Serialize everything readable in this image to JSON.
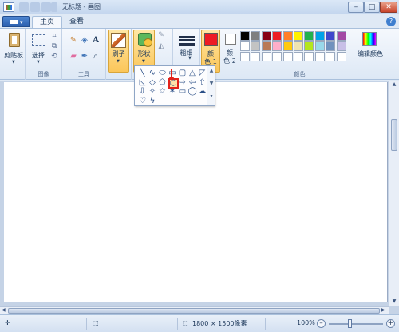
{
  "window": {
    "title_doc": "无标题",
    "title_app": "画图",
    "minimize_glyph": "–",
    "maximize_glyph": "□",
    "close_glyph": "✕"
  },
  "tabs": [
    {
      "label": "主页",
      "active": true
    },
    {
      "label": "查看",
      "active": false
    }
  ],
  "help_glyph": "?",
  "ribbon": {
    "clipboard": {
      "button": "剪贴板",
      "group": ""
    },
    "image": {
      "select": "选择",
      "group": "图像"
    },
    "tools": {
      "group": "工具",
      "pencil": "✎",
      "fill": "◈",
      "text": "A",
      "eraser": "▰",
      "picker": "✒",
      "magnifier": "⌕"
    },
    "brushes": {
      "label": "刷子"
    },
    "shapes": {
      "label": "形状"
    },
    "size": {
      "label": "粗细"
    },
    "color1": {
      "label1": "颜",
      "label2": "色 1",
      "color": "#ed1c24"
    },
    "color2": {
      "label1": "颜",
      "label2": "色 2",
      "color": "#ffffff"
    },
    "colors": {
      "group": "颜色",
      "edit": "编辑颜色",
      "row1": [
        "#000000",
        "#7f7f7f",
        "#880015",
        "#ed1c24",
        "#ff7f27",
        "#fff200",
        "#22b14c",
        "#00a2e8",
        "#3f48cc",
        "#a349a4"
      ],
      "row2": [
        "#ffffff",
        "#c3c3c3",
        "#b97a57",
        "#ffaec9",
        "#ffc90e",
        "#efe4b0",
        "#b5e61d",
        "#99d9ea",
        "#7092be",
        "#c8bfe7"
      ],
      "row3": [
        "#ffffff",
        "#ffffff",
        "#ffffff",
        "#ffffff",
        "#ffffff",
        "#ffffff",
        "#ffffff",
        "#ffffff",
        "#ffffff",
        "#ffffff"
      ]
    }
  },
  "shapes_dropdown": {
    "row1": [
      "╲",
      "∿",
      "⬭",
      "▭",
      "▢",
      "△",
      "◸"
    ],
    "row2": [
      "◺",
      "◇",
      "⬠",
      "⬡",
      "⇨",
      "⇦",
      "⇧"
    ],
    "row3": [
      "⇩",
      "✧",
      "☆",
      "✶",
      "▭",
      "◯",
      "☁"
    ],
    "row4": [
      "♡",
      "ϟ"
    ],
    "highlighted": "hexagon",
    "scroll_up": "▲",
    "scroll_down": "▼",
    "scroll_more": "▾"
  },
  "statusbar": {
    "add_glyph": "✛",
    "selection_glyph": "⬚",
    "size_glyph": "⬚",
    "canvas_size": "1800 × 1500像素",
    "zoom": "100%",
    "zoom_out": "–",
    "zoom_in": "+"
  }
}
